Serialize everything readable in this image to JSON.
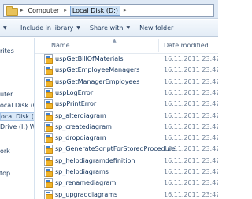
{
  "address": {
    "crumbs": [
      "Computer",
      "Local Disk (D:)"
    ]
  },
  "toolbar": {
    "include_label": "Include in library",
    "share_label": "Share with",
    "new_folder_label": "New folder"
  },
  "nav": {
    "items": [
      "rites",
      "uter",
      "ocal Disk (C:)",
      "ocal Disk (D:)",
      "Drive (I:) W",
      "ork",
      "top"
    ]
  },
  "columns": {
    "name": "Name",
    "date": "Date modified"
  },
  "files": [
    {
      "name": "uspGetBillOfMaterials",
      "date": "16.11.2011 23:47"
    },
    {
      "name": "uspGetEmployeeManagers",
      "date": "16.11.2011 23:47"
    },
    {
      "name": "uspGetManagerEmployees",
      "date": "16.11.2011 23:47"
    },
    {
      "name": "uspLogError",
      "date": "16.11.2011 23:47"
    },
    {
      "name": "uspPrintError",
      "date": "16.11.2011 23:47"
    },
    {
      "name": "sp_alterdiagram",
      "date": "16.11.2011 23:47"
    },
    {
      "name": "sp_creatediagram",
      "date": "16.11.2011 23:47"
    },
    {
      "name": "sp_dropdiagram",
      "date": "16.11.2011 23:47"
    },
    {
      "name": "sp_GenerateScriptForStoredProcedure",
      "date": "16.11.2011 23:47"
    },
    {
      "name": "sp_helpdiagramdefinition",
      "date": "16.11.2011 23:47"
    },
    {
      "name": "sp_helpdiagrams",
      "date": "16.11.2011 23:47"
    },
    {
      "name": "sp_renamediagram",
      "date": "16.11.2011 23:47"
    },
    {
      "name": "sp_upgraddiagrams",
      "date": "16.11.2011 23:47"
    }
  ],
  "colors": {
    "accent": "#cfe3f7",
    "text": "#1e395b"
  }
}
